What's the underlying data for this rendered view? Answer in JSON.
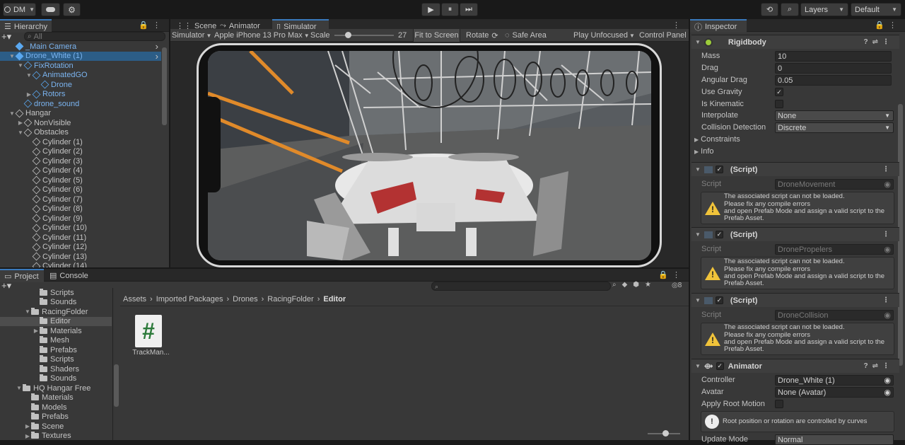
{
  "toolbar": {
    "account": "DM",
    "play": "▶",
    "pause": "⏸",
    "step": "⏭",
    "layers": "Layers",
    "layout": "Default"
  },
  "hierarchy": {
    "tab": "Hierarchy",
    "search_placeholder": "All",
    "items": [
      {
        "label": "_Main Camera",
        "depth": 1,
        "arrow": "",
        "blue": true,
        "sel": false
      },
      {
        "label": "Drone_White (1)",
        "depth": 1,
        "arrow": "▼",
        "blue": true,
        "sel": true
      },
      {
        "label": "FixRotation",
        "depth": 2,
        "arrow": "▼",
        "blue": true,
        "sel": false
      },
      {
        "label": "AnimatedGO",
        "depth": 3,
        "arrow": "▼",
        "blue": true,
        "sel": false
      },
      {
        "label": "Drone",
        "depth": 4,
        "arrow": "",
        "blue": true,
        "sel": false
      },
      {
        "label": "Rotors",
        "depth": 3,
        "arrow": "▶",
        "blue": true,
        "sel": false
      },
      {
        "label": "drone_sound",
        "depth": 2,
        "arrow": "",
        "blue": true,
        "sel": false
      },
      {
        "label": "Hangar",
        "depth": 1,
        "arrow": "▼",
        "blue": false,
        "sel": false
      },
      {
        "label": "NonVisible",
        "depth": 2,
        "arrow": "▶",
        "blue": false,
        "sel": false
      },
      {
        "label": "Obstacles",
        "depth": 2,
        "arrow": "▼",
        "blue": false,
        "sel": false
      },
      {
        "label": "Cylinder (1)",
        "depth": 3,
        "arrow": "",
        "blue": false,
        "sel": false
      },
      {
        "label": "Cylinder (2)",
        "depth": 3,
        "arrow": "",
        "blue": false,
        "sel": false
      },
      {
        "label": "Cylinder (3)",
        "depth": 3,
        "arrow": "",
        "blue": false,
        "sel": false
      },
      {
        "label": "Cylinder (4)",
        "depth": 3,
        "arrow": "",
        "blue": false,
        "sel": false
      },
      {
        "label": "Cylinder (5)",
        "depth": 3,
        "arrow": "",
        "blue": false,
        "sel": false
      },
      {
        "label": "Cylinder (6)",
        "depth": 3,
        "arrow": "",
        "blue": false,
        "sel": false
      },
      {
        "label": "Cylinder (7)",
        "depth": 3,
        "arrow": "",
        "blue": false,
        "sel": false
      },
      {
        "label": "Cylinder (8)",
        "depth": 3,
        "arrow": "",
        "blue": false,
        "sel": false
      },
      {
        "label": "Cylinder (9)",
        "depth": 3,
        "arrow": "",
        "blue": false,
        "sel": false
      },
      {
        "label": "Cylinder (10)",
        "depth": 3,
        "arrow": "",
        "blue": false,
        "sel": false
      },
      {
        "label": "Cylinder (11)",
        "depth": 3,
        "arrow": "",
        "blue": false,
        "sel": false
      },
      {
        "label": "Cylinder (12)",
        "depth": 3,
        "arrow": "",
        "blue": false,
        "sel": false
      },
      {
        "label": "Cylinder (13)",
        "depth": 3,
        "arrow": "",
        "blue": false,
        "sel": false
      },
      {
        "label": "Cylinder (14)",
        "depth": 3,
        "arrow": "",
        "blue": false,
        "sel": false
      }
    ]
  },
  "center": {
    "tabs": [
      "Scene",
      "Animator",
      "Simulator"
    ],
    "sim_toolbar": {
      "mode": "Simulator",
      "device": "Apple iPhone 13 Pro Max",
      "scale_label": "Scale",
      "scale_value": "27",
      "fit": "Fit to Screen",
      "rotate": "Rotate",
      "safe_area": "Safe Area",
      "play_mode": "Play Unfocused",
      "control_panel": "Control Panel"
    }
  },
  "project": {
    "tabs": [
      "Project",
      "Console"
    ],
    "badge": "8",
    "breadcrumb": [
      "Assets",
      "Imported Packages",
      "Drones",
      "RacingFolder",
      "Editor"
    ],
    "tree": [
      {
        "label": "Scripts",
        "depth": 2,
        "arrow": ""
      },
      {
        "label": "Sounds",
        "depth": 2,
        "arrow": ""
      },
      {
        "label": "RacingFolder",
        "depth": 1,
        "arrow": "▼"
      },
      {
        "label": "Editor",
        "depth": 2,
        "arrow": "",
        "sel": true
      },
      {
        "label": "Materials",
        "depth": 2,
        "arrow": "▶"
      },
      {
        "label": "Mesh",
        "depth": 2,
        "arrow": ""
      },
      {
        "label": "Prefabs",
        "depth": 2,
        "arrow": ""
      },
      {
        "label": "Scripts",
        "depth": 2,
        "arrow": ""
      },
      {
        "label": "Shaders",
        "depth": 2,
        "arrow": ""
      },
      {
        "label": "Sounds",
        "depth": 2,
        "arrow": ""
      },
      {
        "label": "HQ Hangar Free",
        "depth": 0,
        "arrow": "▼"
      },
      {
        "label": "Materials",
        "depth": 1,
        "arrow": ""
      },
      {
        "label": "Models",
        "depth": 1,
        "arrow": ""
      },
      {
        "label": "Prefabs",
        "depth": 1,
        "arrow": ""
      },
      {
        "label": "Scene",
        "depth": 1,
        "arrow": "▶"
      },
      {
        "label": "Textures",
        "depth": 1,
        "arrow": "▶"
      }
    ],
    "asset": {
      "name": "TrackMan...",
      "glyph": "#"
    }
  },
  "inspector": {
    "tab": "Inspector",
    "rigidbody": {
      "title": "Rigidbody",
      "mass_label": "Mass",
      "mass": "10",
      "drag_label": "Drag",
      "drag": "0",
      "adrag_label": "Angular Drag",
      "adrag": "0.05",
      "gravity_label": "Use Gravity",
      "kinematic_label": "Is Kinematic",
      "interp_label": "Interpolate",
      "interp": "None",
      "coll_label": "Collision Detection",
      "coll": "Discrete",
      "constraints": "Constraints",
      "info": "Info"
    },
    "scripts": [
      {
        "title": "(Script)",
        "script_label": "Script",
        "script": "DroneMovement"
      },
      {
        "title": "(Script)",
        "script_label": "Script",
        "script": "DronePropelers"
      },
      {
        "title": "(Script)",
        "script_label": "Script",
        "script": "DroneCollision"
      }
    ],
    "warning": [
      "The associated script can not be loaded.",
      "Please fix any compile errors",
      "and open Prefab Mode and assign a valid script to the",
      "Prefab Asset."
    ],
    "animator": {
      "title": "Animator",
      "controller_label": "Controller",
      "controller": "Drone_White (1)",
      "avatar_label": "Avatar",
      "avatar": "None (Avatar)",
      "root_label": "Apply Root Motion",
      "root_note": "Root position or rotation are controlled by curves",
      "update_label": "Update Mode",
      "update": "Normal"
    }
  }
}
